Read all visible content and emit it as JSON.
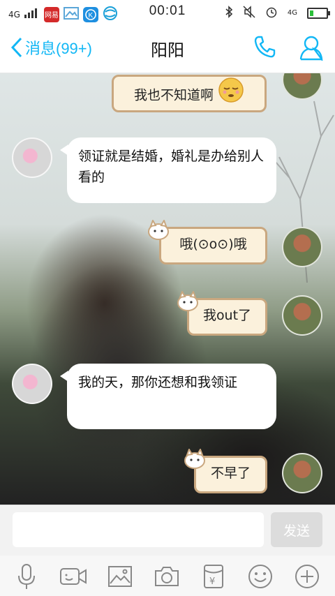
{
  "status_bar": {
    "network": "4G",
    "app_icon_1": "网易",
    "time": "00:01",
    "net_right": "4G"
  },
  "header": {
    "back_label": "消息(99+)",
    "title": "阳阳"
  },
  "messages": [
    {
      "side": "right",
      "style": "cute",
      "text": "我也不知道啊"
    },
    {
      "side": "left",
      "style": "white",
      "text": "领证就是结婚，婚礼是办给别人看的"
    },
    {
      "side": "right",
      "style": "cute",
      "text": "哦(⊙o⊙)哦"
    },
    {
      "side": "right",
      "style": "cute",
      "text": "我out了"
    },
    {
      "side": "left",
      "style": "white",
      "text": "我的天，那你还想和我领证"
    },
    {
      "side": "right",
      "style": "cute",
      "text": "不早了"
    }
  ],
  "input": {
    "placeholder": "",
    "send_label": "发送"
  },
  "toolbar_icons": [
    "microphone-icon",
    "video-icon",
    "image-icon",
    "camera-icon",
    "red-packet-icon",
    "emoji-icon",
    "plus-icon"
  ],
  "colors": {
    "accent": "#12b7f5",
    "send_disabled": "#dcdcdc",
    "cute_border": "#c9a77f",
    "cute_fill": "#fbf1dc"
  }
}
